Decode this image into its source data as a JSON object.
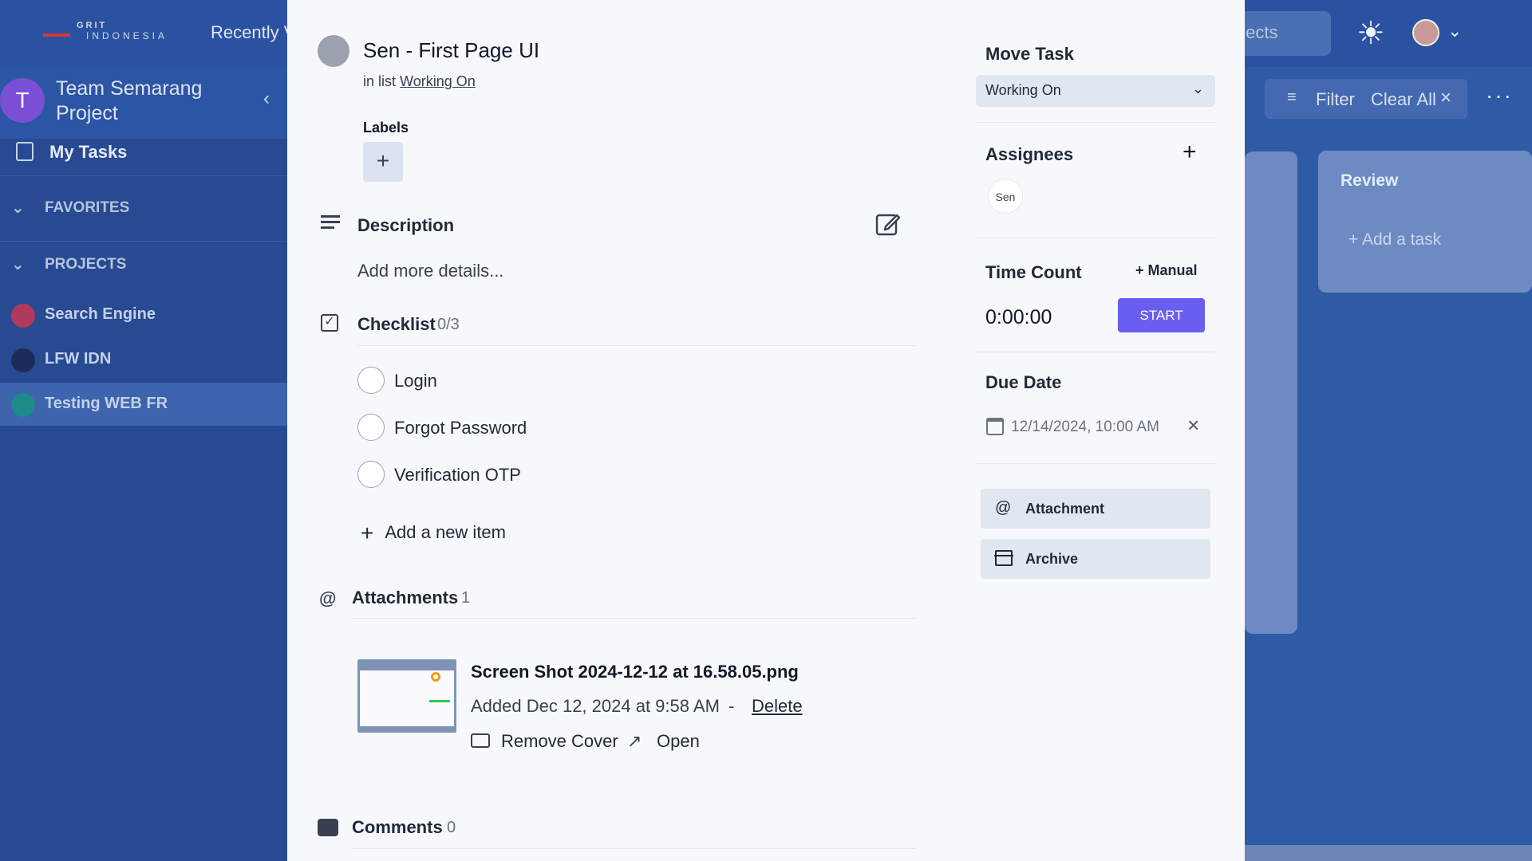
{
  "background": {
    "logo": {
      "line1": "GRIT",
      "line2": "INDONESIA"
    },
    "recent_label": "Recently V",
    "search_placeholder": "ojects",
    "team": {
      "initial": "T",
      "name": "Team Semarang Project"
    },
    "my_tasks": "My Tasks",
    "favorites": "FAVORITES",
    "projects_label": "PROJECTS",
    "projects": [
      {
        "name": "Search Engine",
        "color": "#b03a5b"
      },
      {
        "name": "LFW IDN",
        "color": "#1d2b5a"
      },
      {
        "name": "Testing WEB FR",
        "color": "#1f8a8a"
      }
    ],
    "filter_label": "Filter",
    "clear_all_label": "Clear All",
    "review_column": {
      "title": "Review",
      "add_task": "+ Add a task"
    }
  },
  "task": {
    "title": "Sen - First Page UI",
    "in_list_prefix": "in list",
    "list_name": "Working On",
    "labels_title": "Labels",
    "description_title": "Description",
    "description_placeholder": "Add more details...",
    "checklist_title": "Checklist",
    "checklist_count": "0/3",
    "checklist_items": [
      "Login",
      "Forgot Password",
      "Verification OTP"
    ],
    "add_item_label": "Add a new item",
    "attachments_title": "Attachments",
    "attachments_count": "1",
    "attachment": {
      "filename": "Screen Shot 2024-12-12 at 16.58.05.png",
      "added": "Added Dec 12, 2024 at 9:58 AM",
      "delete_label": "Delete",
      "remove_cover_label": "Remove Cover",
      "open_label": "Open"
    },
    "comments_title": "Comments",
    "comments_count": "0"
  },
  "sidebar_panel": {
    "move_task_title": "Move Task",
    "move_task_value": "Working On",
    "assignees_title": "Assignees",
    "assignee_alt": "Sen",
    "time_count_title": "Time Count",
    "manual_label": "Manual",
    "time_value": "0:00:00",
    "start_label": "START",
    "due_date_title": "Due Date",
    "due_date_value": "12/14/2024, 10:00 AM",
    "attachment_button": "Attachment",
    "archive_button": "Archive"
  },
  "colors": {
    "accent": "#6a5ef0",
    "backdrop": "#2f5aa6",
    "modal_bg": "#f6f8fc"
  }
}
